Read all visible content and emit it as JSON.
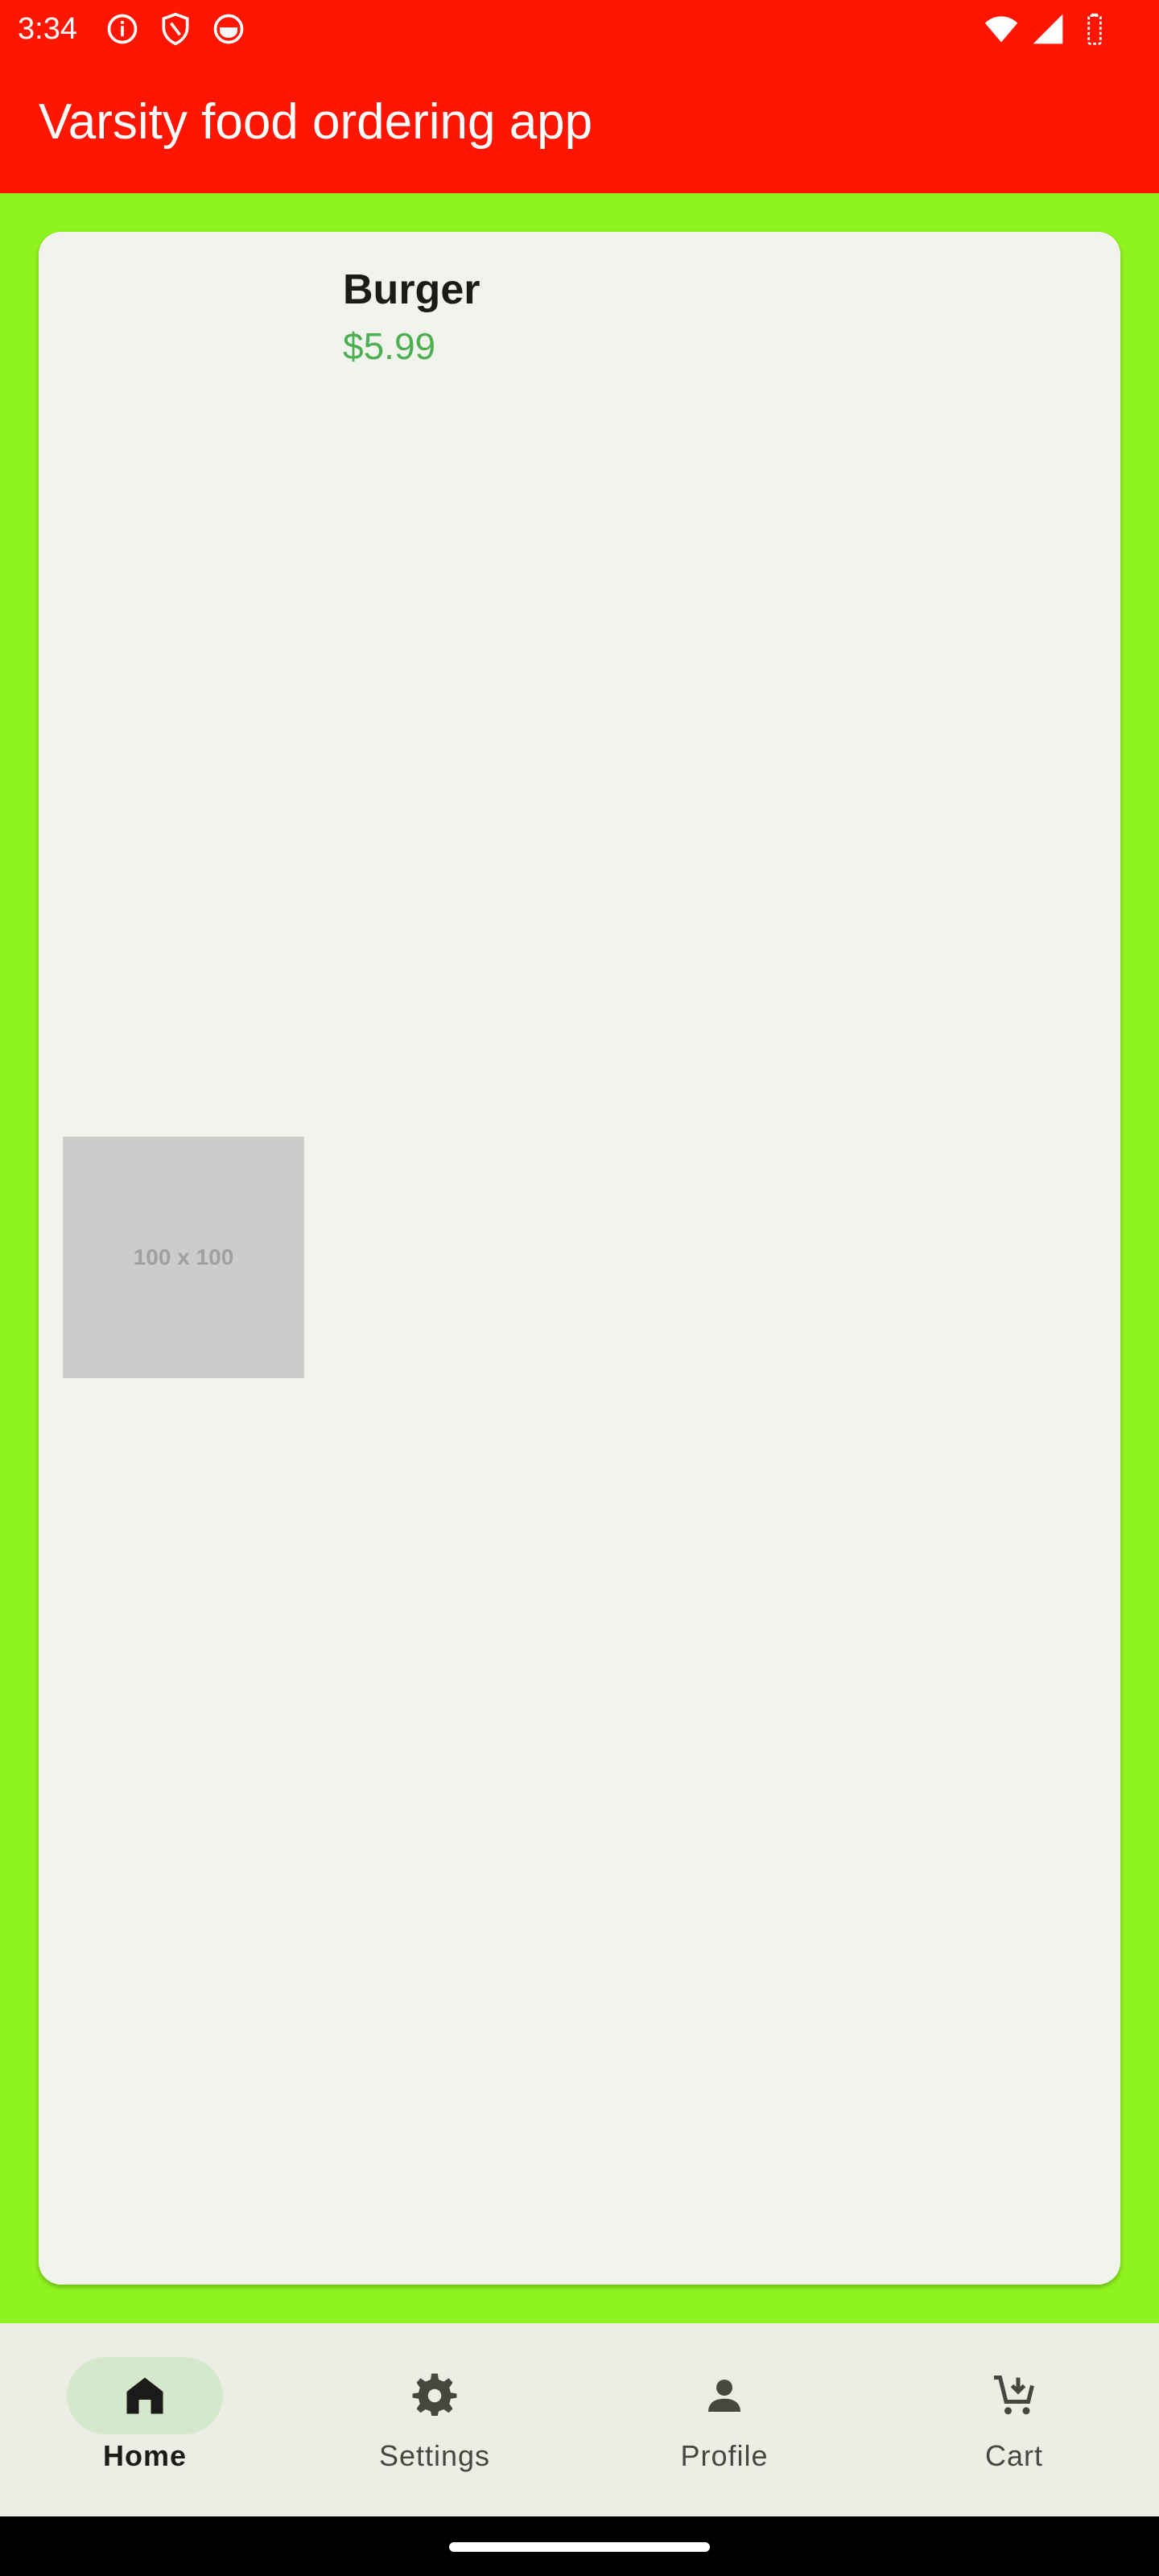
{
  "status_bar": {
    "time": "3:34",
    "left_icons": [
      "info-icon",
      "shield-icon",
      "notification-app-icon"
    ],
    "right_icons": [
      "wifi-icon",
      "signal-icon",
      "battery-icon"
    ]
  },
  "app_bar": {
    "title": "Varsity food ordering app",
    "background": "#ff1500"
  },
  "content": {
    "background": "#8ff31f",
    "item": {
      "image_placeholder": "100 x 100",
      "name": "Burger",
      "price": "$5.99",
      "price_color": "#4caf50"
    }
  },
  "bottom_nav": {
    "items": [
      {
        "label": "Home",
        "icon": "home-icon",
        "active": true
      },
      {
        "label": "Settings",
        "icon": "gear-icon",
        "active": false
      },
      {
        "label": "Profile",
        "icon": "person-icon",
        "active": false
      },
      {
        "label": "Cart",
        "icon": "cart-add-icon",
        "active": false
      }
    ]
  }
}
